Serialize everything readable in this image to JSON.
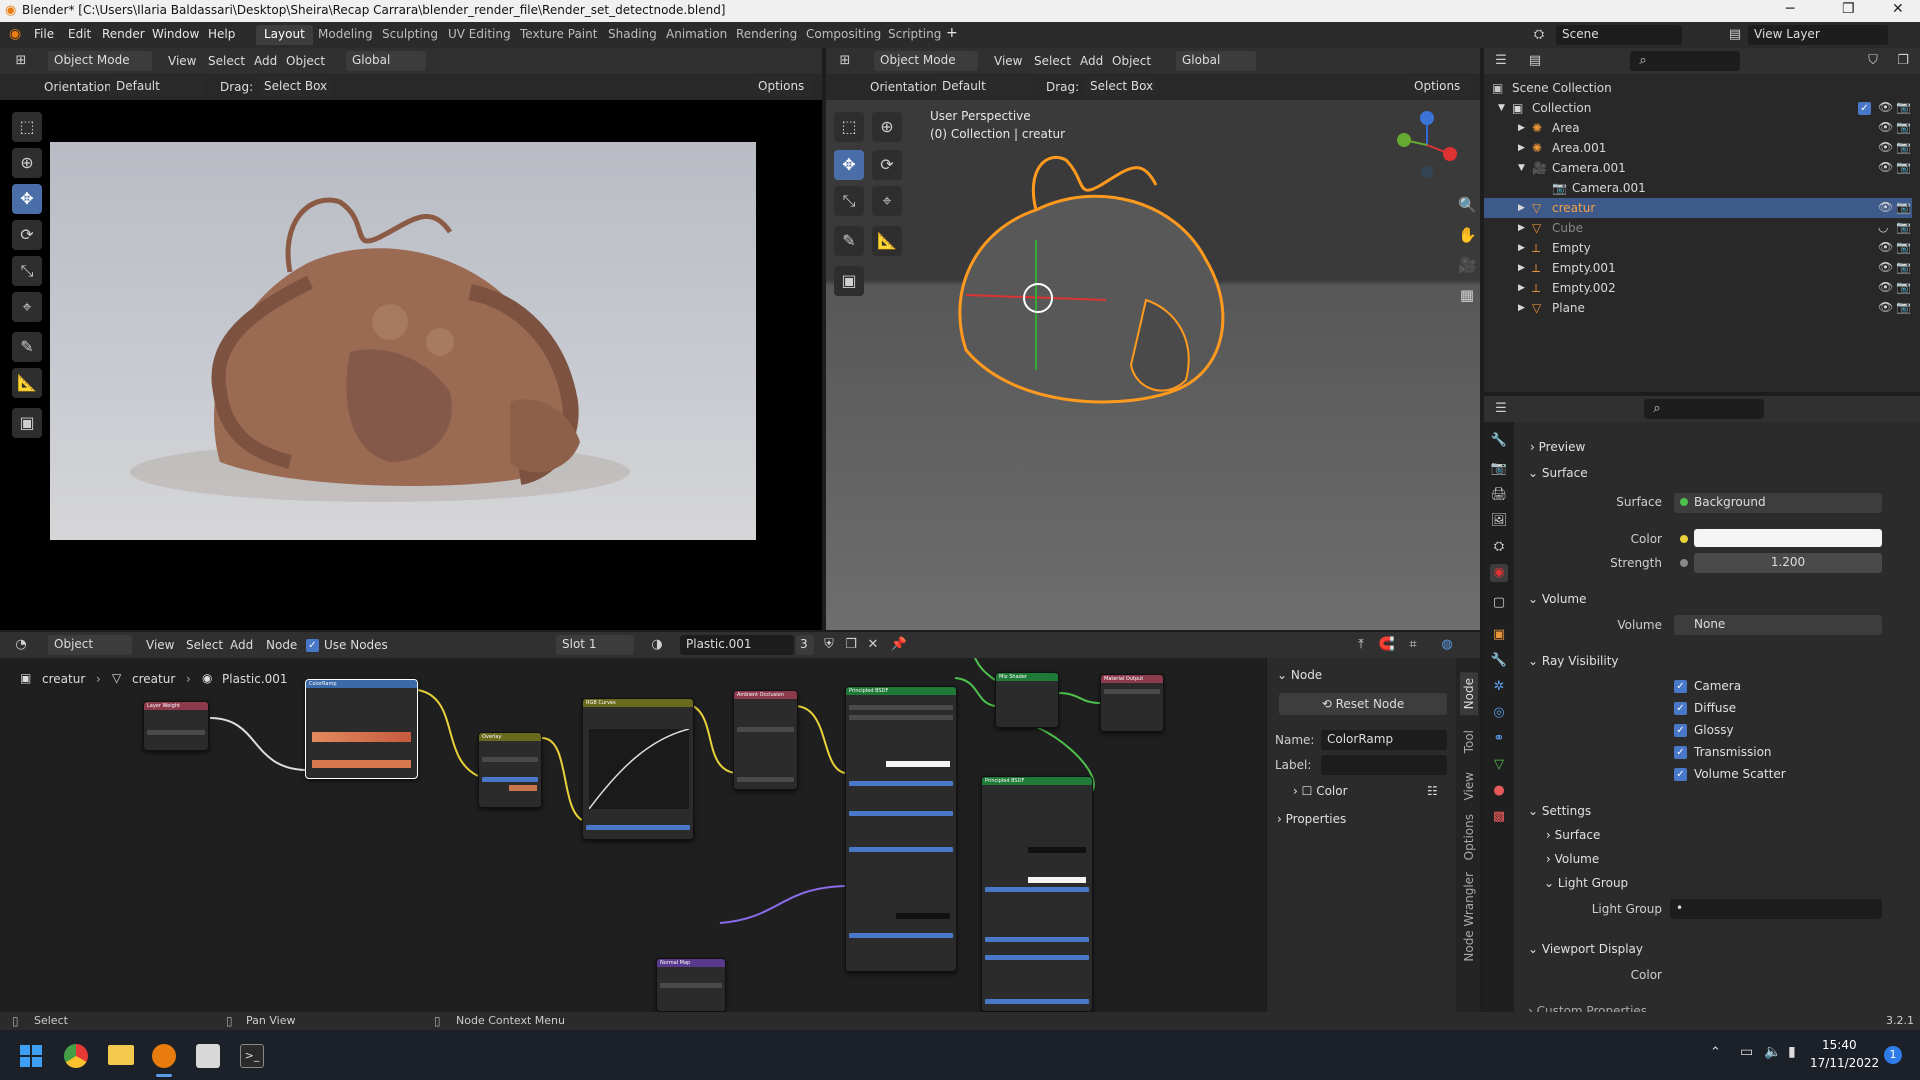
{
  "window": {
    "title": "Blender* [C:\\Users\\Ilaria Baldassari\\Desktop\\Sheira\\Recap Carrara\\blender_render_file\\Render_set_detectnode.blend]"
  },
  "menu": {
    "items": [
      "File",
      "Edit",
      "Render",
      "Window",
      "Help"
    ]
  },
  "workspaces": [
    "Layout",
    "Modeling",
    "Sculpting",
    "UV Editing",
    "Texture Paint",
    "Shading",
    "Animation",
    "Rendering",
    "Compositing",
    "Scripting"
  ],
  "scene": {
    "name": "Scene",
    "view_layer": "View Layer"
  },
  "left_view": {
    "mode": "Object Mode",
    "menus": [
      "View",
      "Select",
      "Add",
      "Object"
    ],
    "transform": "Global",
    "orientation_label": "Orientation:",
    "orientation": "Default",
    "drag_label": "Drag:",
    "drag": "Select Box",
    "options": "Options"
  },
  "right_view": {
    "mode": "Object Mode",
    "menus": [
      "View",
      "Select",
      "Add",
      "Object"
    ],
    "transform": "Global",
    "orientation_label": "Orientation:",
    "orientation": "Default",
    "drag_label": "Drag:",
    "drag": "Select Box",
    "options": "Options",
    "perspective": "User Perspective",
    "collection_info": "(0) Collection | creatur"
  },
  "outliner": {
    "root": "Scene Collection",
    "collection": "Collection",
    "items": [
      {
        "name": "Area",
        "indent": 1
      },
      {
        "name": "Area.001",
        "indent": 1
      },
      {
        "name": "Camera.001",
        "indent": 1
      },
      {
        "name": "Camera.001",
        "indent": 2
      },
      {
        "name": "creatur",
        "indent": 1,
        "selected": true
      },
      {
        "name": "Cube",
        "indent": 1,
        "dim": true
      },
      {
        "name": "Empty",
        "indent": 1
      },
      {
        "name": "Empty.001",
        "indent": 1
      },
      {
        "name": "Empty.002",
        "indent": 1
      },
      {
        "name": "Plane",
        "indent": 1
      }
    ]
  },
  "properties": {
    "preview": "Preview",
    "surface_section": "Surface",
    "surface_label": "Surface",
    "surface_value": "Background",
    "color_label": "Color",
    "strength_label": "Strength",
    "strength_value": "1.200",
    "volume_section": "Volume",
    "volume_label": "Volume",
    "volume_value": "None",
    "ray_section": "Ray Visibility",
    "ray_items": [
      "Camera",
      "Diffuse",
      "Glossy",
      "Transmission",
      "Volume Scatter"
    ],
    "settings_section": "Settings",
    "settings_items": [
      "Surface",
      "Volume",
      "Light Group"
    ],
    "light_group_label": "Light Group",
    "viewport_section": "Viewport Display",
    "viewport_color": "Color",
    "custom": "Custom Properties"
  },
  "node_editor": {
    "type": "Object",
    "menus": [
      "View",
      "Select",
      "Add",
      "Node"
    ],
    "use_nodes": "Use Nodes",
    "slot": "Slot 1",
    "material": "Plastic.001",
    "users": "3",
    "breadcrumb": [
      "creatur",
      "creatur",
      "Plastic.001"
    ],
    "side_tabs": [
      "Node",
      "Tool",
      "View",
      "Options",
      "Node Wrangler"
    ],
    "panel": {
      "header": "Node",
      "reset": "Reset Node",
      "name_label": "Name:",
      "name_value": "ColorRamp",
      "label_label": "Label:",
      "color_sub": "Color",
      "properties_sub": "Properties"
    },
    "nodes": [
      "Layer Weight",
      "ColorRamp",
      "Overlay",
      "RGB Curves",
      "Ambient Occlusion",
      "Principled BSDF",
      "Mix Shader",
      "Material Output",
      "Principled BSDF",
      "Normal Map"
    ]
  },
  "status": {
    "select": "Select",
    "pan": "Pan View",
    "ctx": "Node Context Menu",
    "version": "3.2.1"
  },
  "taskbar": {
    "time": "15:40",
    "date": "17/11/2022",
    "badge": "1"
  }
}
